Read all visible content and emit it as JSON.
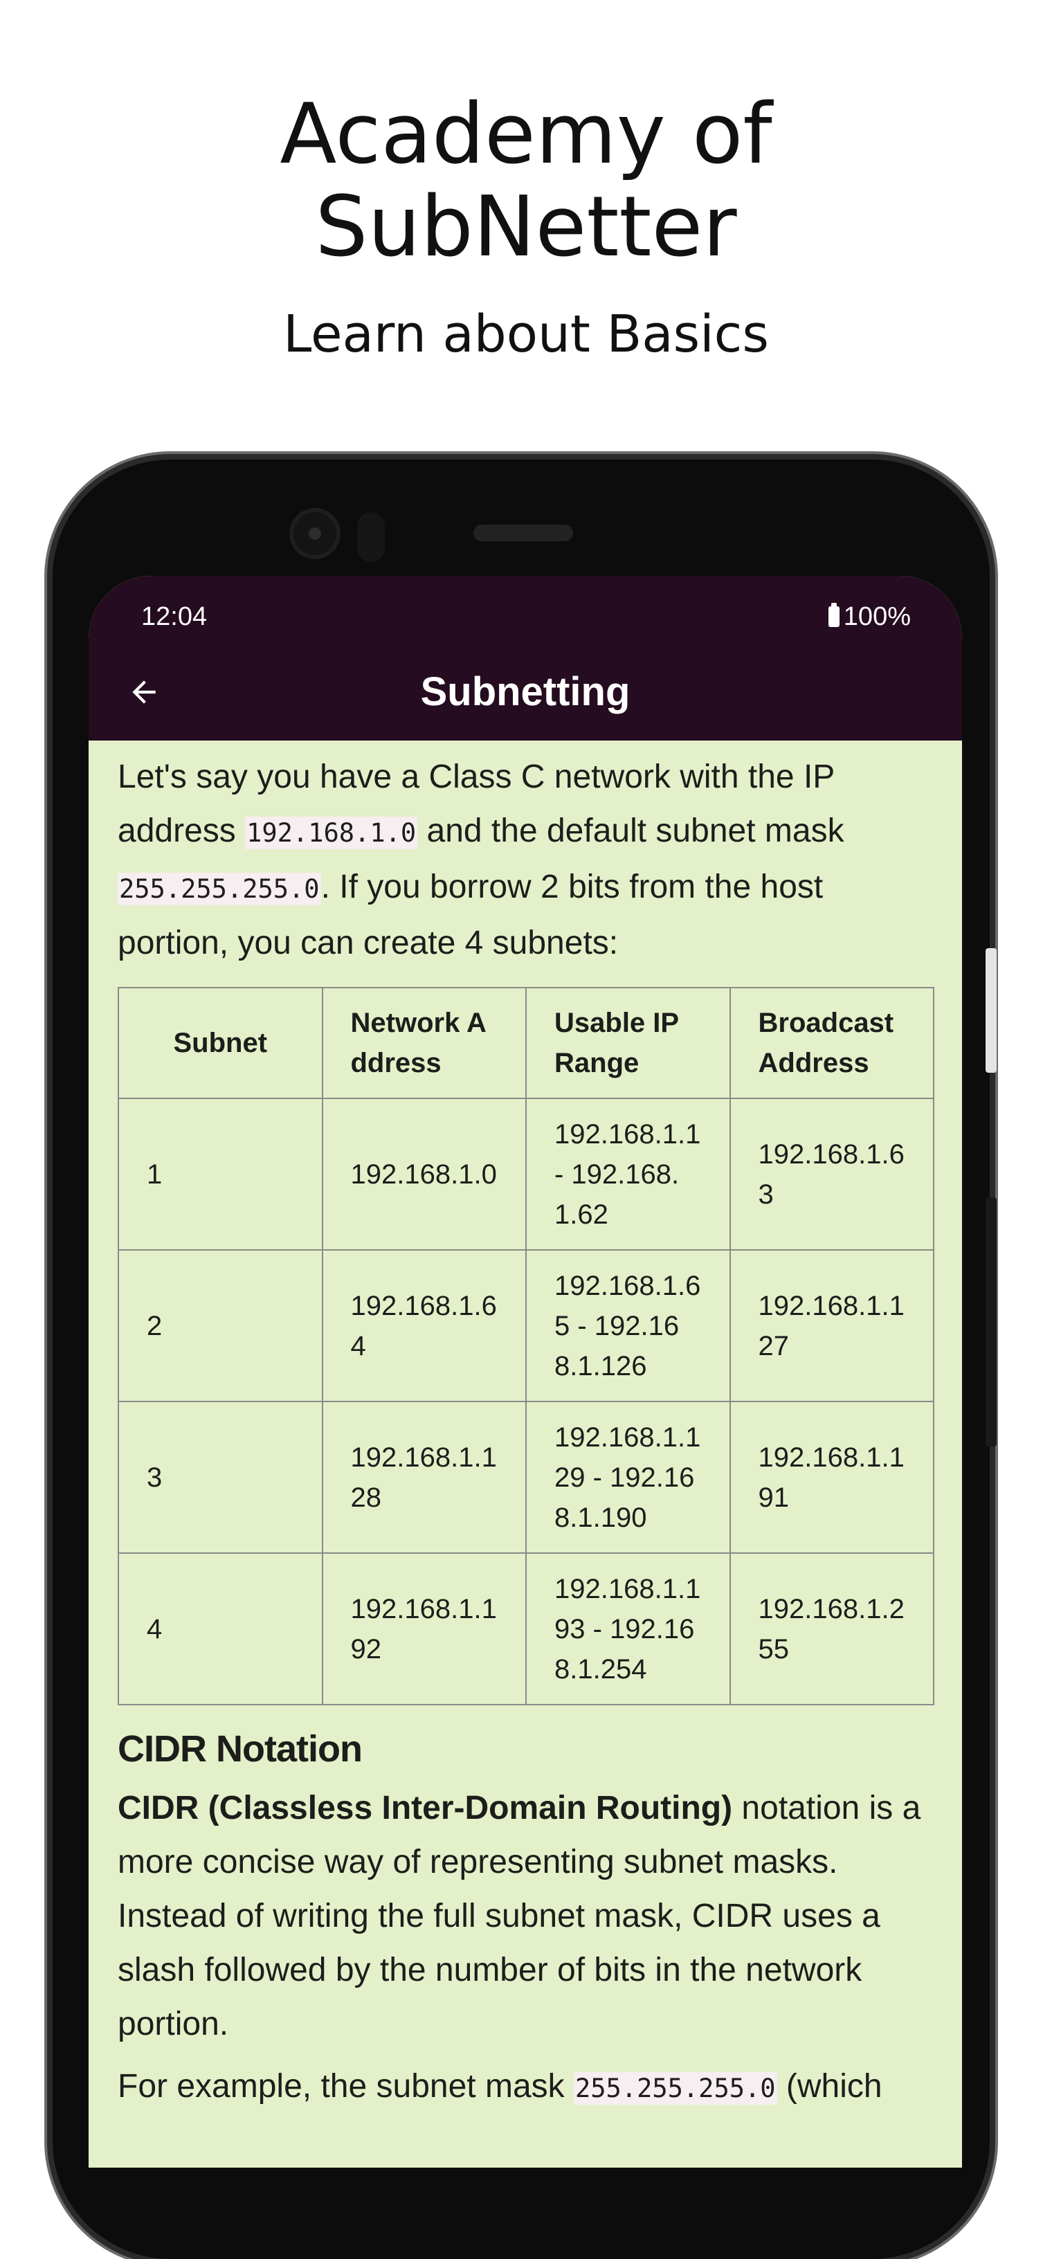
{
  "hero": {
    "title_line1": "Academy of",
    "title_line2": "SubNetter",
    "subtitle": "Learn about Basics"
  },
  "status_bar": {
    "time": "12:04",
    "battery": "100%"
  },
  "app_bar": {
    "title": "Subnetting",
    "back_icon": "arrow-left-icon"
  },
  "intro": {
    "text1": "Let's say you have a Class C network with the IP address ",
    "code1": "192.168.1.0",
    "text2": " and the default subnet mask ",
    "code2": "255.255.255.0",
    "text3": ". If you borrow 2 bits from the host portion, you can create 4 subnets:"
  },
  "table": {
    "headers": [
      "Subnet",
      "Network Address",
      "Usable IP Range",
      "Broadcast Address"
    ],
    "rows": [
      [
        "1",
        "192.168.1.0",
        "192.168.1.1 - 192.168.1.62",
        "192.168.1.63"
      ],
      [
        "2",
        "192.168.1.64",
        "192.168.1.65 - 192.168.1.126",
        "192.168.1.127"
      ],
      [
        "3",
        "192.168.1.128",
        "192.168.1.129 - 192.168.1.190",
        "192.168.1.191"
      ],
      [
        "4",
        "192.168.1.192",
        "192.168.1.193 - 192.168.1.254",
        "192.168.1.255"
      ]
    ]
  },
  "cidr": {
    "heading": "CIDR Notation",
    "bold": "CIDR (Classless Inter-Domain Routing)",
    "text": " notation is a more concise way of representing subnet masks. Instead of writing the full subnet mask, CIDR uses a slash followed by the number of bits in the network portion.",
    "example_text": "For example, the subnet mask ",
    "example_code": "255.255.255.0",
    "example_tail": " (which"
  },
  "colors": {
    "app_bar": "#250c20",
    "content_bg": "#e4f0c9",
    "code_bg": "#f6eef0"
  }
}
